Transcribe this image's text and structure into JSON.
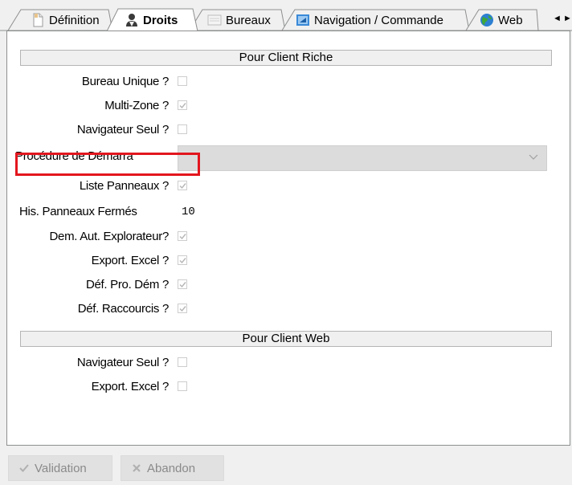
{
  "tabs": [
    {
      "label": "Définition",
      "icon": "definition-icon",
      "active": false
    },
    {
      "label": "Droits",
      "icon": "user-rights-icon",
      "active": true
    },
    {
      "label": "Bureaux",
      "icon": "desktop-icon",
      "active": false
    },
    {
      "label": "Navigation / Commande",
      "icon": "navigation-icon",
      "active": false
    },
    {
      "label": "Web",
      "icon": "globe-icon",
      "active": false
    }
  ],
  "tab_scroll": {
    "left": "◄",
    "right": "►"
  },
  "sections": {
    "riche": "Pour Client Riche",
    "web": "Pour Client Web"
  },
  "fields": {
    "bureau_unique": {
      "label": "Bureau Unique ?",
      "checked": false
    },
    "multi_zone": {
      "label": "Multi-Zone ?",
      "checked": true
    },
    "navigateur_seul": {
      "label": "Navigateur Seul ?",
      "checked": false
    },
    "procedure_demarrage": {
      "label": "Procédure de Démarra",
      "value": ""
    },
    "liste_panneaux": {
      "label": "Liste Panneaux ?",
      "checked": true
    },
    "his_panneaux_fermes": {
      "label": "His. Panneaux Fermés",
      "value": "10"
    },
    "dem_aut_explorateur": {
      "label": "Dem. Aut. Explorateur?",
      "checked": true
    },
    "export_excel": {
      "label": "Export. Excel ?",
      "checked": true
    },
    "def_pro_dem": {
      "label": "Déf. Pro. Dém ?",
      "checked": true
    },
    "def_raccourcis": {
      "label": "Déf. Raccourcis ?",
      "checked": true
    },
    "web_navigateur_seul": {
      "label": "Navigateur Seul ?",
      "checked": false
    },
    "web_export_excel": {
      "label": "Export. Excel ?",
      "checked": false
    }
  },
  "buttons": {
    "validation": "Validation",
    "abandon": "Abandon"
  },
  "colors": {
    "highlight": "#e3161e",
    "panel_bg": "#ffffff",
    "window_bg": "#f0f0f0"
  }
}
